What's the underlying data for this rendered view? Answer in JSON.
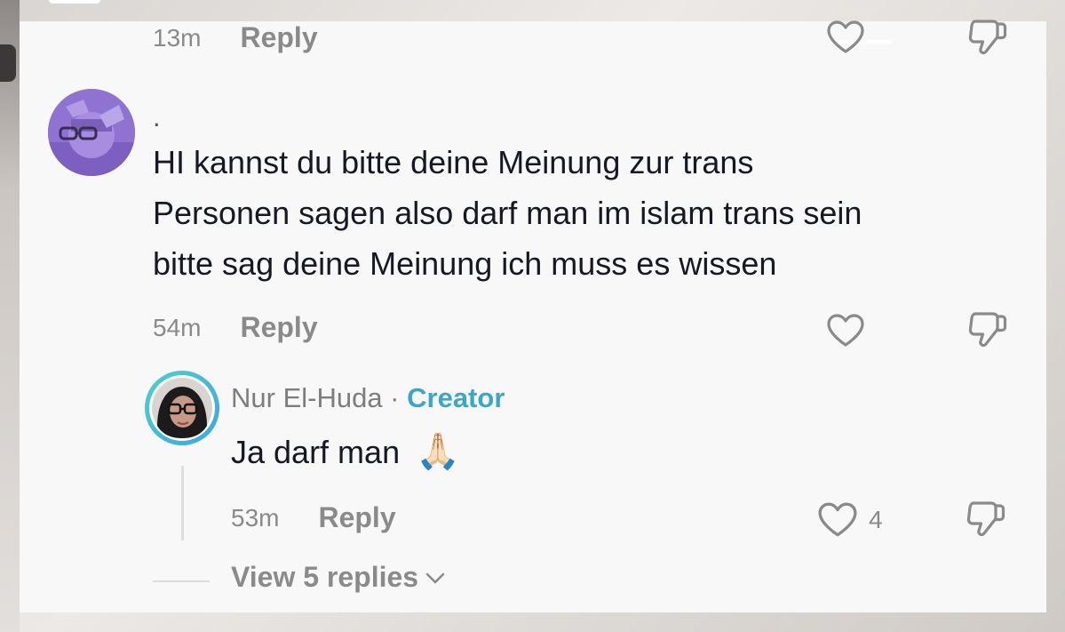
{
  "top_comment": {
    "time": "13m",
    "reply_label": "Reply"
  },
  "comment": {
    "username": ".",
    "lines": [
      "HI kannst du bitte deine Meinung zur trans",
      "Personen sagen also darf man im islam trans sein",
      "bitte sag deine Meinung ich muss es wissen"
    ],
    "time": "54m",
    "reply_label": "Reply"
  },
  "reply": {
    "username": "Nur El-Huda",
    "separator": " · ",
    "badge": "Creator",
    "text": "Ja darf man",
    "emoji": "🙏🏻",
    "time": "53m",
    "reply_label": "Reply",
    "like_count": "4"
  },
  "view_replies": {
    "label": "View 5 replies"
  },
  "icons": {
    "like": "heart-outline-icon",
    "dislike": "thumbs-down-outline-icon",
    "expand": "chevron-down-icon"
  },
  "colors": {
    "text": "#161823",
    "muted": "#8a8a8a",
    "creator": "#3aa7c9",
    "avatar_purple": "#8f6fd1"
  }
}
